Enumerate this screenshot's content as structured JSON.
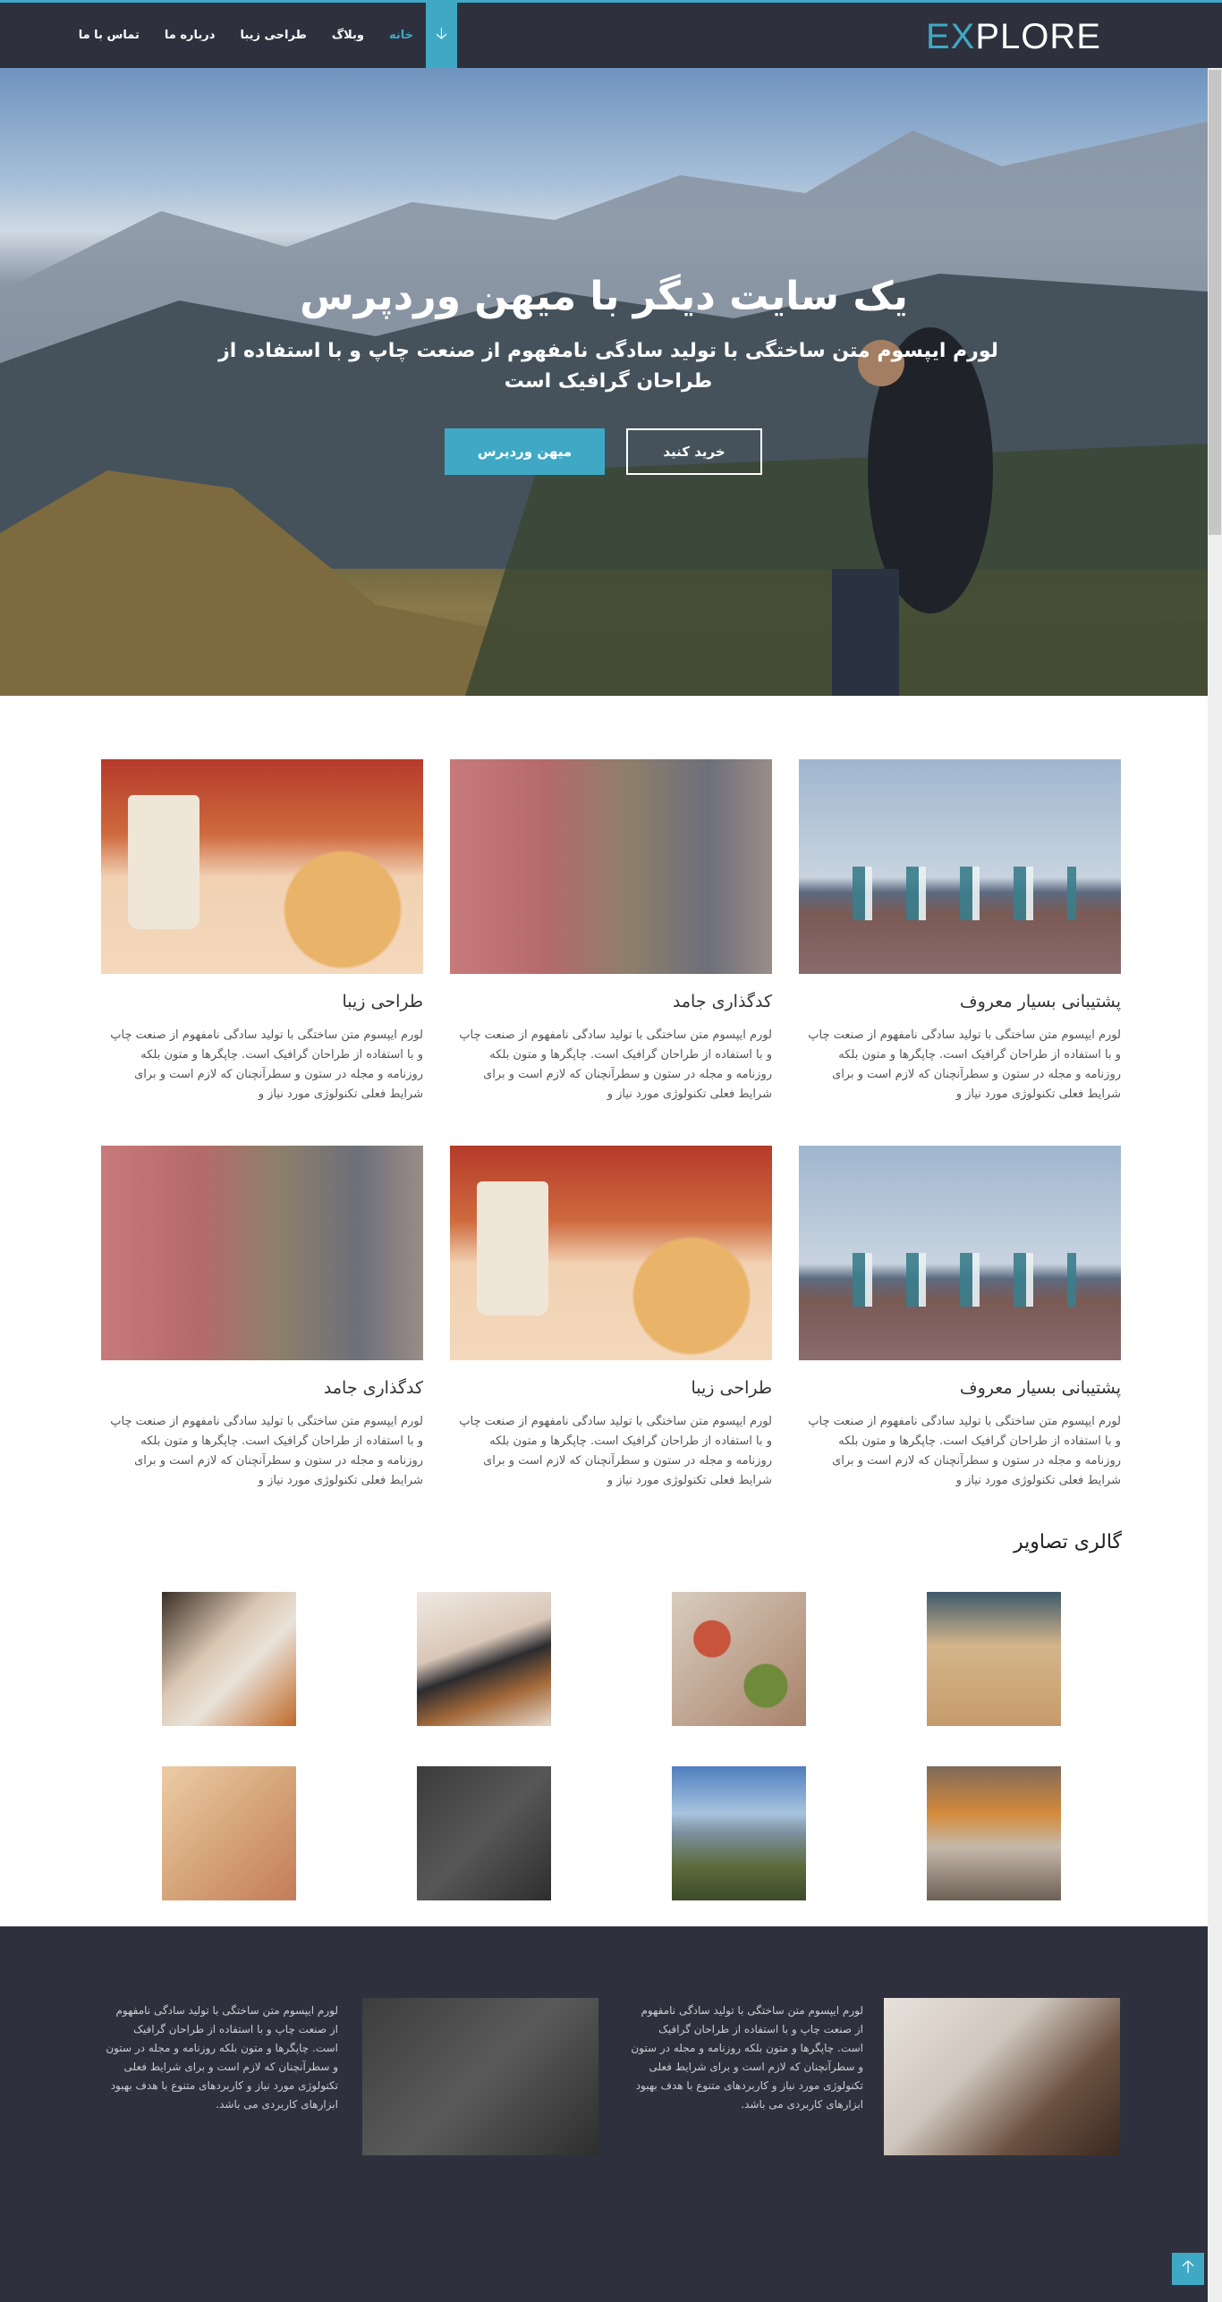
{
  "header": {
    "logo_prefix": "EX",
    "logo_suffix": "PLORE",
    "nav": [
      {
        "label": "خانه"
      },
      {
        "label": "وبلاگ"
      },
      {
        "label": "طراحی زیبا"
      },
      {
        "label": "درباره ما"
      },
      {
        "label": "تماس با ما"
      }
    ],
    "toggle_icon": "arrow-down-icon"
  },
  "hero": {
    "title": "یک سایت دیگر با میهن وردپرس",
    "subtitle": "لورم ایپسوم متن ساختگی با تولید سادگی نامفهوم از صنعت چاپ و با استفاده از طراحان گرافیک است",
    "primary_button": "میهن وردپرس",
    "secondary_button": "خرید کنید"
  },
  "features": [
    {
      "title": "پشتیبانی بسیار معروف",
      "text": "لورم ایپسوم متن ساختگی با تولید سادگی نامفهوم از صنعت چاپ و با استفاده از طراحان گرافیک است. چاپگرها و متون بلکه روزنامه و مجله در ستون و سطرآنچنان که لازم است و برای شرایط فعلی تکنولوژی مورد نیاز و"
    },
    {
      "title": "کدگذاری جامد",
      "text": "لورم ایپسوم متن ساختگی با تولید سادگی نامفهوم از صنعت چاپ و با استفاده از طراحان گرافیک است. چاپگرها و متون بلکه روزنامه و مجله در ستون و سطرآنچنان که لازم است و برای شرایط فعلی تکنولوژی مورد نیاز و"
    },
    {
      "title": "طراحی زیبا",
      "text": "لورم ایپسوم متن ساختگی با تولید سادگی نامفهوم از صنعت چاپ و با استفاده از طراحان گرافیک است. چاپگرها و متون بلکه روزنامه و مجله در ستون و سطرآنچنان که لازم است و برای شرایط فعلی تکنولوژی مورد نیاز و"
    },
    {
      "title": "پشتیبانی بسیار معروف",
      "text": "لورم ایپسوم متن ساختگی با تولید سادگی نامفهوم از صنعت چاپ و با استفاده از طراحان گرافیک است. چاپگرها و متون بلکه روزنامه و مجله در ستون و سطرآنچنان که لازم است و برای شرایط فعلی تکنولوژی مورد نیاز و"
    },
    {
      "title": "طراحی زیبا",
      "text": "لورم ایپسوم متن ساختگی با تولید سادگی نامفهوم از صنعت چاپ و با استفاده از طراحان گرافیک است. چاپگرها و متون بلکه روزنامه و مجله در ستون و سطرآنچنان که لازم است و برای شرایط فعلی تکنولوژی مورد نیاز و"
    },
    {
      "title": "کدگذاری جامد",
      "text": "لورم ایپسوم متن ساختگی با تولید سادگی نامفهوم از صنعت چاپ و با استفاده از طراحان گرافیک است. چاپگرها و متون بلکه روزنامه و مجله در ستون و سطرآنچنان که لازم است و برای شرایط فعلی تکنولوژی مورد نیاز و"
    }
  ],
  "gallery": {
    "title": "گالری تصاویر"
  },
  "footer": {
    "text1": "لورم ایپسوم متن ساختگی با تولید سادگی نامفهوم از صنعت چاپ و با استفاده از طراحان گرافیک است. چاپگرها و متون بلکه روزنامه و مجله در ستون و سطرآنچنان که لازم است و برای شرایط فعلی تکنولوژی مورد نیاز و کاربردهای متنوع با هدف بهبود ابزارهای کاربردی می باشد.",
    "text2": "لورم ایپسوم متن ساختگی با تولید سادگی نامفهوم از صنعت چاپ و با استفاده از طراحان گرافیک است. چاپگرها و متون بلکه روزنامه و مجله در ستون و سطرآنچنان که لازم است و برای شرایط فعلی تکنولوژی مورد نیاز و کاربردهای متنوع با هدف بهبود ابزارهای کاربردی می باشد.",
    "back_to_top_icon": "arrow-up-icon"
  },
  "colors": {
    "accent": "#3fa9c5",
    "dark": "#2e313d"
  }
}
